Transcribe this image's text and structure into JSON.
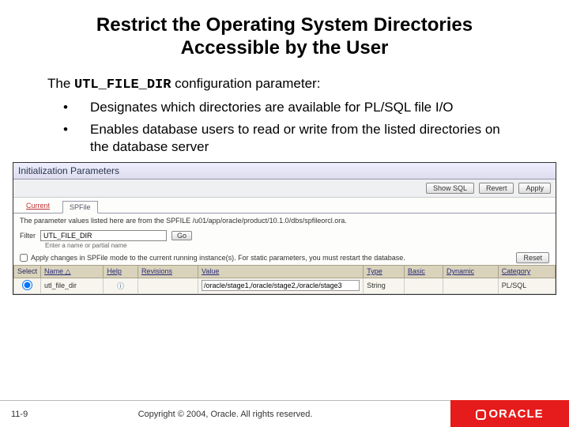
{
  "title": "Restrict the Operating System Directories Accessible by the User",
  "intro_pre": "The ",
  "intro_code": "UTL_FILE_DIR",
  "intro_post": " configuration parameter:",
  "bullets": [
    "Designates which directories are available for PL/SQL file I/O",
    "Enables database users to read or write from the listed directories on the database server"
  ],
  "em": {
    "heading": "Initialization Parameters",
    "buttons": {
      "show_sql": "Show SQL",
      "revert": "Revert",
      "apply": "Apply",
      "go": "Go",
      "reset": "Reset"
    },
    "tabs": {
      "current": "Current",
      "spfile": "SPFile"
    },
    "note": "The parameter values listed here are from the SPFILE /u01/app/oracle/product/10.1.0/dbs/spfileorcl.ora.",
    "filter_label": "Filter",
    "filter_value": "UTL_FILE_DIR",
    "filter_hint": "Enter a name or partial name",
    "apply_text": "Apply changes in SPFile mode to the current running instance(s). For static parameters, you must restart the database.",
    "columns": {
      "select": "Select",
      "name": "Name",
      "help": "Help",
      "revisions": "Revisions",
      "value": "Value",
      "type": "Type",
      "basic": "Basic",
      "dynamic": "Dynamic",
      "category": "Category"
    },
    "row": {
      "name": "utl_file_dir",
      "value": "/oracle/stage1,/oracle/stage2,/oracle/stage3",
      "type": "String",
      "category": "PL/SQL"
    }
  },
  "footer": {
    "page": "11-9",
    "copyright": "Copyright © 2004, Oracle.  All rights reserved.",
    "brand": "ORACLE"
  }
}
